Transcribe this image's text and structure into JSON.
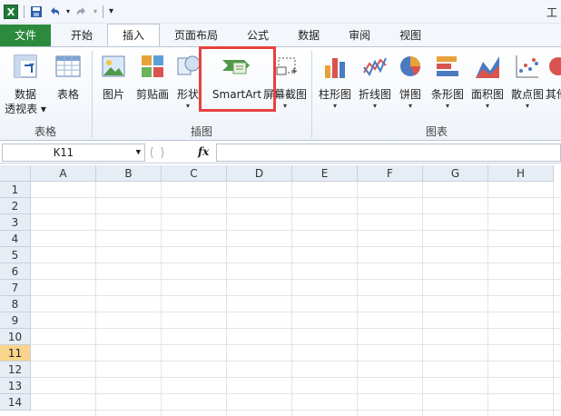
{
  "qat": {
    "excel_icon": "X",
    "title": "工"
  },
  "tabs": [
    {
      "label": "文件"
    },
    {
      "label": "开始"
    },
    {
      "label": "插入"
    },
    {
      "label": "页面布局"
    },
    {
      "label": "公式"
    },
    {
      "label": "数据"
    },
    {
      "label": "审阅"
    },
    {
      "label": "视图"
    }
  ],
  "ribbon": {
    "tables": {
      "pivot_line1": "数据",
      "pivot_line2": "透视表",
      "table": "表格",
      "group": "表格"
    },
    "illustrations": {
      "picture": "图片",
      "clipart": "剪贴画",
      "shapes": "形状",
      "smartart": "SmartArt",
      "screenshot": "屏幕截图",
      "group": "插图"
    },
    "charts": {
      "column": "柱形图",
      "line": "折线图",
      "pie": "饼图",
      "bar": "条形图",
      "area": "面积图",
      "scatter": "散点图",
      "other": "其他",
      "group": "图表"
    },
    "colors": {
      "highlight": "#e8403e",
      "file_tab": "#2c8a3c"
    }
  },
  "formula_bar": {
    "cell_ref": "K11",
    "fx": "fx"
  },
  "grid": {
    "columns": [
      "A",
      "B",
      "C",
      "D",
      "E",
      "F",
      "G",
      "H"
    ],
    "rows": [
      "1",
      "2",
      "3",
      "4",
      "5",
      "6",
      "7",
      "8",
      "9",
      "10",
      "11",
      "12",
      "13",
      "14"
    ],
    "active_row": "11"
  }
}
